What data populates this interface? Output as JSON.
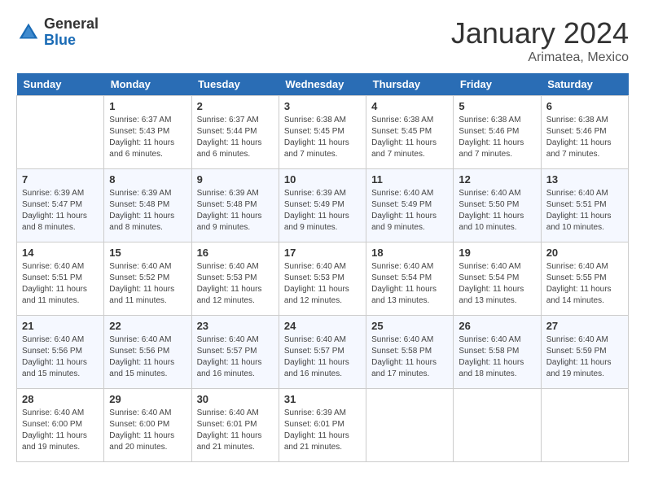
{
  "header": {
    "logo": {
      "general": "General",
      "blue": "Blue"
    },
    "title": "January 2024",
    "location": "Arimatea, Mexico"
  },
  "weekdays": [
    "Sunday",
    "Monday",
    "Tuesday",
    "Wednesday",
    "Thursday",
    "Friday",
    "Saturday"
  ],
  "weeks": [
    [
      {
        "day": "",
        "info": ""
      },
      {
        "day": "1",
        "info": "Sunrise: 6:37 AM\nSunset: 5:43 PM\nDaylight: 11 hours and 6 minutes."
      },
      {
        "day": "2",
        "info": "Sunrise: 6:37 AM\nSunset: 5:44 PM\nDaylight: 11 hours and 6 minutes."
      },
      {
        "day": "3",
        "info": "Sunrise: 6:38 AM\nSunset: 5:45 PM\nDaylight: 11 hours and 7 minutes."
      },
      {
        "day": "4",
        "info": "Sunrise: 6:38 AM\nSunset: 5:45 PM\nDaylight: 11 hours and 7 minutes."
      },
      {
        "day": "5",
        "info": "Sunrise: 6:38 AM\nSunset: 5:46 PM\nDaylight: 11 hours and 7 minutes."
      },
      {
        "day": "6",
        "info": "Sunrise: 6:38 AM\nSunset: 5:46 PM\nDaylight: 11 hours and 7 minutes."
      }
    ],
    [
      {
        "day": "7",
        "info": "Sunrise: 6:39 AM\nSunset: 5:47 PM\nDaylight: 11 hours and 8 minutes."
      },
      {
        "day": "8",
        "info": "Sunrise: 6:39 AM\nSunset: 5:48 PM\nDaylight: 11 hours and 8 minutes."
      },
      {
        "day": "9",
        "info": "Sunrise: 6:39 AM\nSunset: 5:48 PM\nDaylight: 11 hours and 9 minutes."
      },
      {
        "day": "10",
        "info": "Sunrise: 6:39 AM\nSunset: 5:49 PM\nDaylight: 11 hours and 9 minutes."
      },
      {
        "day": "11",
        "info": "Sunrise: 6:40 AM\nSunset: 5:49 PM\nDaylight: 11 hours and 9 minutes."
      },
      {
        "day": "12",
        "info": "Sunrise: 6:40 AM\nSunset: 5:50 PM\nDaylight: 11 hours and 10 minutes."
      },
      {
        "day": "13",
        "info": "Sunrise: 6:40 AM\nSunset: 5:51 PM\nDaylight: 11 hours and 10 minutes."
      }
    ],
    [
      {
        "day": "14",
        "info": "Sunrise: 6:40 AM\nSunset: 5:51 PM\nDaylight: 11 hours and 11 minutes."
      },
      {
        "day": "15",
        "info": "Sunrise: 6:40 AM\nSunset: 5:52 PM\nDaylight: 11 hours and 11 minutes."
      },
      {
        "day": "16",
        "info": "Sunrise: 6:40 AM\nSunset: 5:53 PM\nDaylight: 11 hours and 12 minutes."
      },
      {
        "day": "17",
        "info": "Sunrise: 6:40 AM\nSunset: 5:53 PM\nDaylight: 11 hours and 12 minutes."
      },
      {
        "day": "18",
        "info": "Sunrise: 6:40 AM\nSunset: 5:54 PM\nDaylight: 11 hours and 13 minutes."
      },
      {
        "day": "19",
        "info": "Sunrise: 6:40 AM\nSunset: 5:54 PM\nDaylight: 11 hours and 13 minutes."
      },
      {
        "day": "20",
        "info": "Sunrise: 6:40 AM\nSunset: 5:55 PM\nDaylight: 11 hours and 14 minutes."
      }
    ],
    [
      {
        "day": "21",
        "info": "Sunrise: 6:40 AM\nSunset: 5:56 PM\nDaylight: 11 hours and 15 minutes."
      },
      {
        "day": "22",
        "info": "Sunrise: 6:40 AM\nSunset: 5:56 PM\nDaylight: 11 hours and 15 minutes."
      },
      {
        "day": "23",
        "info": "Sunrise: 6:40 AM\nSunset: 5:57 PM\nDaylight: 11 hours and 16 minutes."
      },
      {
        "day": "24",
        "info": "Sunrise: 6:40 AM\nSunset: 5:57 PM\nDaylight: 11 hours and 16 minutes."
      },
      {
        "day": "25",
        "info": "Sunrise: 6:40 AM\nSunset: 5:58 PM\nDaylight: 11 hours and 17 minutes."
      },
      {
        "day": "26",
        "info": "Sunrise: 6:40 AM\nSunset: 5:58 PM\nDaylight: 11 hours and 18 minutes."
      },
      {
        "day": "27",
        "info": "Sunrise: 6:40 AM\nSunset: 5:59 PM\nDaylight: 11 hours and 19 minutes."
      }
    ],
    [
      {
        "day": "28",
        "info": "Sunrise: 6:40 AM\nSunset: 6:00 PM\nDaylight: 11 hours and 19 minutes."
      },
      {
        "day": "29",
        "info": "Sunrise: 6:40 AM\nSunset: 6:00 PM\nDaylight: 11 hours and 20 minutes."
      },
      {
        "day": "30",
        "info": "Sunrise: 6:40 AM\nSunset: 6:01 PM\nDaylight: 11 hours and 21 minutes."
      },
      {
        "day": "31",
        "info": "Sunrise: 6:39 AM\nSunset: 6:01 PM\nDaylight: 11 hours and 21 minutes."
      },
      {
        "day": "",
        "info": ""
      },
      {
        "day": "",
        "info": ""
      },
      {
        "day": "",
        "info": ""
      }
    ]
  ]
}
